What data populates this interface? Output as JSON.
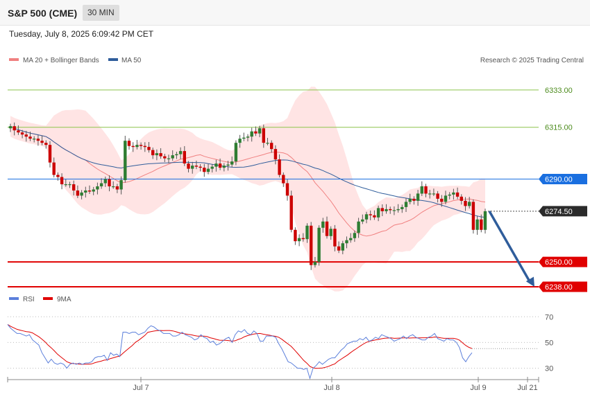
{
  "header": {
    "title": "S&P 500 (CME)",
    "timeframe": "30 MIN",
    "datetime": "Tuesday, July 8, 2025 6:09:42 PM CET"
  },
  "legend": {
    "ma20": "MA 20 + Bollinger Bands",
    "ma50": "MA 50",
    "credit": "Research © 2025 Trading Central",
    "rsi": "RSI",
    "rsi_ma": "9MA"
  },
  "colors": {
    "ma20": "#f08080",
    "ma50": "#2f5d9b",
    "bollinger_fill": "#ffd9d9",
    "bullish": "#2e7d32",
    "bearish": "#cc0000",
    "resistance_green": "#4caf50",
    "pivot_blue": "#1a6fe0",
    "support_red": "#e00000",
    "rsi": "#5b7fdb",
    "rsi_ma": "#e00000"
  },
  "chart_data": {
    "type": "candlestick",
    "price_range": [
      6236,
      6343
    ],
    "x_ticks": [
      "Jul 7",
      "Jul 8",
      "Jul 9",
      "Jul 21"
    ],
    "levels": [
      {
        "label": "6333.00",
        "value": 6333.0,
        "kind": "resistance"
      },
      {
        "label": "6315.00",
        "value": 6315.0,
        "kind": "resistance"
      },
      {
        "label": "6290.00",
        "value": 6290.0,
        "kind": "pivot"
      },
      {
        "label": "6274.50",
        "value": 6274.5,
        "kind": "last"
      },
      {
        "label": "6250.00",
        "value": 6250.0,
        "kind": "support"
      },
      {
        "label": "6238.00",
        "value": 6238.0,
        "kind": "support"
      }
    ],
    "forecast": {
      "from": 6274.5,
      "to": 6238.0
    },
    "closes": [
      6315.5,
      6313.5,
      6312.5,
      6311.5,
      6310.5,
      6309.5,
      6309.5,
      6308.5,
      6307.5,
      6306.5,
      6298.0,
      6292.0,
      6291.0,
      6287.5,
      6287.5,
      6287.5,
      6284.5,
      6282.0,
      6283.5,
      6284.5,
      6284.0,
      6285.0,
      6286.5,
      6288.0,
      6290.0,
      6286.5,
      6286.5,
      6285.0,
      6289.5,
      6308.5,
      6306.0,
      6305.5,
      6306.5,
      6306.0,
      6305.5,
      6304.0,
      6301.5,
      6302.5,
      6301.0,
      6300.0,
      6300.0,
      6301.5,
      6302.0,
      6303.5,
      6297.5,
      6295.0,
      6296.5,
      6296.0,
      6295.5,
      6293.5,
      6295.0,
      6296.0,
      6297.5,
      6295.5,
      6296.5,
      6297.0,
      6298.5,
      6307.5,
      6309.5,
      6310.0,
      6310.5,
      6313.0,
      6312.0,
      6314.5,
      6307.5,
      6307.5,
      6304.5,
      6299.5,
      6292.0,
      6288.0,
      6282.0,
      6265.5,
      6260.0,
      6261.5,
      6261.0,
      6267.5,
      6248.5,
      6250.0,
      6266.5,
      6269.5,
      6262.5,
      6266.0,
      6257.5,
      6255.5,
      6259.0,
      6260.5,
      6261.5,
      6264.0,
      6269.5,
      6270.5,
      6273.0,
      6272.5,
      6271.5,
      6276.0,
      6274.5,
      6275.5,
      6275.0,
      6275.0,
      6275.5,
      6276.5,
      6279.0,
      6280.5,
      6279.5,
      6283.0,
      6286.5,
      6283.0,
      6283.0,
      6283.0,
      6280.5,
      6279.0,
      6282.0,
      6282.5,
      6283.5,
      6281.5,
      6279.5,
      6277.0,
      6279.0,
      6265.5,
      6270.5,
      6265.5,
      6274.5
    ],
    "rsi": {
      "range": [
        20,
        75
      ],
      "ticks": [
        70,
        50,
        30
      ],
      "rsi_values": [
        64,
        61,
        59,
        57,
        57,
        56,
        55,
        56,
        52,
        50,
        48,
        42,
        38,
        34,
        37,
        34,
        33,
        34,
        33,
        30,
        33,
        34,
        33,
        34,
        33,
        34,
        34,
        35,
        38,
        39,
        39,
        40,
        36,
        42,
        40,
        41,
        39,
        58,
        58,
        57,
        58,
        58,
        56,
        57,
        58,
        61,
        63,
        62,
        60,
        59,
        57,
        57,
        57,
        55,
        55,
        56,
        58,
        56,
        55,
        54,
        52,
        53,
        56,
        54,
        53,
        50,
        51,
        48,
        49,
        51,
        53,
        54,
        50,
        56,
        59,
        58,
        60,
        57,
        56,
        59,
        57,
        51,
        51,
        55,
        55,
        55,
        54,
        49,
        45,
        40,
        35,
        34,
        32,
        30,
        30,
        29,
        30,
        22,
        30,
        32,
        35,
        33,
        35,
        37,
        38,
        38,
        41,
        44,
        46,
        49,
        50,
        51,
        51,
        53,
        52,
        54,
        51,
        52,
        54,
        53,
        56,
        55,
        54,
        53,
        51,
        52,
        53,
        55,
        53,
        55,
        56,
        54,
        53,
        52,
        52,
        54,
        55,
        57,
        53,
        52,
        51,
        53,
        52,
        52,
        50,
        46,
        38,
        35,
        39,
        42
      ]
    }
  }
}
